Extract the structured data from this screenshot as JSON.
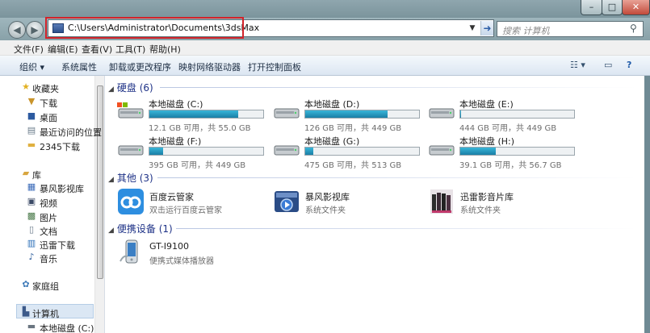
{
  "address": {
    "path": "C:\\Users\\Administrator\\Documents\\3dsMax"
  },
  "search": {
    "placeholder": "搜索 计算机"
  },
  "menu": [
    "文件(F)",
    "编辑(E)",
    "查看(V)",
    "工具(T)",
    "帮助(H)"
  ],
  "toolbar": {
    "organize": "组织 ▾",
    "system_properties": "系统属性",
    "uninstall": "卸载或更改程序",
    "map_drive": "映射网络驱动器",
    "control_panel": "打开控制面板"
  },
  "nav": {
    "favorites": "收藏夹",
    "downloads": "下载",
    "desktop": "桌面",
    "recent": "最近访问的位置",
    "dl2345": "2345下载",
    "libraries": "库",
    "baofeng": "暴风影视库",
    "videos": "视频",
    "pictures": "图片",
    "documents": "文档",
    "xunlei": "迅雷下载",
    "music": "音乐",
    "homegroup": "家庭组",
    "computer": "计算机",
    "local_c": "本地磁盘 (C:)"
  },
  "groups": {
    "disks": "硬盘 (6)",
    "other": "其他 (3)",
    "portable": "便携设备 (1)"
  },
  "drives": [
    {
      "name": "本地磁盘 (C:)",
      "size": "12.1 GB 可用，共 55.0 GB",
      "used_fraction": 0.78,
      "color": "#1a7fa6"
    },
    {
      "name": "本地磁盘 (D:)",
      "size": "126 GB 可用，共 449 GB",
      "used_fraction": 0.72,
      "color": "#1a7fa6"
    },
    {
      "name": "本地磁盘 (E:)",
      "size": "444 GB 可用，共 449 GB",
      "used_fraction": 0.01,
      "color": "#1a7fa6"
    },
    {
      "name": "本地磁盘 (F:)",
      "size": "395 GB 可用，共 449 GB",
      "used_fraction": 0.12,
      "color": "#1a7fa6"
    },
    {
      "name": "本地磁盘 (G:)",
      "size": "475 GB 可用，共 513 GB",
      "used_fraction": 0.07,
      "color": "#1a7fa6"
    },
    {
      "name": "本地磁盘 (H:)",
      "size": "39.1 GB 可用，共 56.7 GB",
      "used_fraction": 0.31,
      "color": "#1a7fa6"
    }
  ],
  "others": [
    {
      "name": "百度云管家",
      "sub": "双击运行百度云管家",
      "icon": "baidu-cloud-icon"
    },
    {
      "name": "暴风影视库",
      "sub": "系统文件夹",
      "icon": "baofeng-library-icon"
    },
    {
      "name": "迅雷影音片库",
      "sub": "系统文件夹",
      "icon": "xunlei-library-icon"
    }
  ],
  "portable": [
    {
      "name": "GT-I9100",
      "sub": "便携式媒体播放器",
      "icon": "phone-icon"
    }
  ],
  "window_buttons": {
    "min": "–",
    "max": "□",
    "close": "✕"
  }
}
